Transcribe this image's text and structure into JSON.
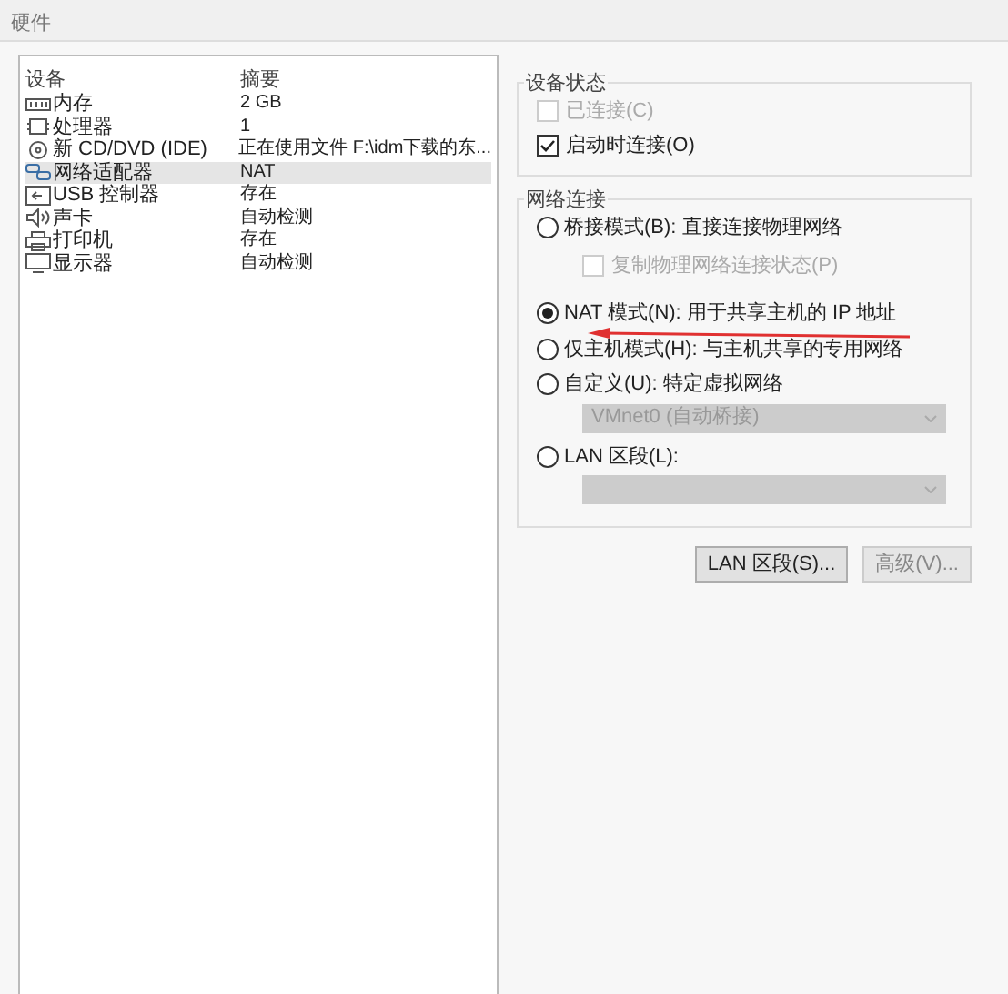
{
  "window": {
    "title": "硬件"
  },
  "device_table": {
    "columns": [
      "设备",
      "摘要"
    ],
    "rows": [
      {
        "kind": "memory",
        "device": "内存",
        "summary": "2 GB",
        "selected": false
      },
      {
        "kind": "cpu",
        "device": "处理器",
        "summary": "1",
        "selected": false
      },
      {
        "kind": "cdrom",
        "device": "新 CD/DVD (IDE)",
        "summary": "正在使用文件 F:\\idm下载的东...",
        "selected": false
      },
      {
        "kind": "network",
        "device": "网络适配器",
        "summary": "NAT",
        "selected": true
      },
      {
        "kind": "usb",
        "device": "USB 控制器",
        "summary": "存在",
        "selected": false
      },
      {
        "kind": "sound",
        "device": "声卡",
        "summary": "自动检测",
        "selected": false
      },
      {
        "kind": "printer",
        "device": "打印机",
        "summary": "存在",
        "selected": false
      },
      {
        "kind": "display",
        "device": "显示器",
        "summary": "自动检测",
        "selected": false
      }
    ]
  },
  "device_status": {
    "title": "设备状态",
    "options": [
      {
        "label": "已连接(C)",
        "checked": false,
        "disabled": true
      },
      {
        "label": "启动时连接(O)",
        "checked": true,
        "disabled": false
      }
    ]
  },
  "network_connection": {
    "title": "网络连接",
    "options": [
      {
        "label": "桥接模式(B): 直接连接物理网络",
        "selected": false,
        "sub": {
          "kind": "checkbox",
          "label": "复制物理网络连接状态(P)",
          "checked": false,
          "disabled": true
        }
      },
      {
        "label": "NAT 模式(N): 用于共享主机的 IP 地址",
        "selected": true
      },
      {
        "label": "仅主机模式(H): 与主机共享的专用网络",
        "selected": false
      },
      {
        "label": "自定义(U): 特定虚拟网络",
        "selected": false,
        "sub": {
          "kind": "dropdown",
          "value": "VMnet0 (自动桥接)",
          "disabled": true
        }
      },
      {
        "label": "LAN 区段(L):",
        "selected": false,
        "sub": {
          "kind": "dropdown",
          "disabled": true
        }
      }
    ]
  },
  "buttons": [
    {
      "label": "LAN 区段(S)...",
      "disabled": false
    },
    {
      "label": "高级(V)...",
      "disabled": true
    }
  ]
}
